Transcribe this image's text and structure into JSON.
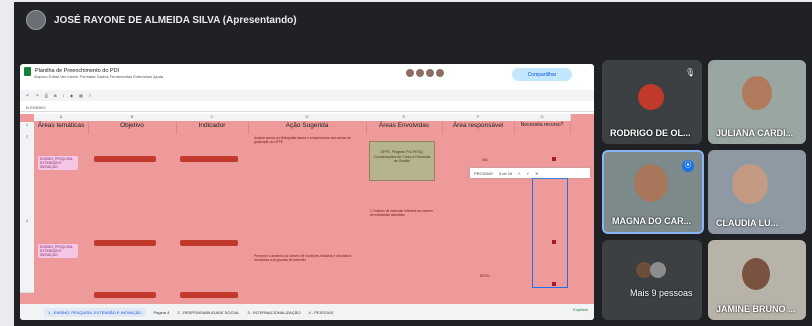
{
  "presenter": {
    "label": "JOSÉ RAYONE DE ALMEIDA SILVA (Apresentando)"
  },
  "sheet": {
    "title": "Planilha de Preenchimento do PDI",
    "menu": "Arquivo  Editar  Ver  Inserir  Formatar  Dados  Ferramentas  Extensões  Ajuda",
    "share_label": "Compartilhar",
    "formula": "fx  ENSINO",
    "find_label": "PROXIMO",
    "find_count": "3 de 16",
    "headers": [
      "Áreas temáticas",
      "Objetivo",
      "Indicador",
      "Ação Sugerida",
      "Áreas Envolvidas",
      "Área responsável",
      "Necessita recurso?"
    ],
    "rows": [
      {
        "area": "ENSINO, PESQUISA, EXTENSÃO E INOVAÇÃO",
        "action": "Ampliar acervo da bibliografia básica e complementar dos cursos de graduação do UFPE",
        "envolvidas": "UFPE, Program Pró-PESQ, Coordenações de Curso e Diretorias de Gestão",
        "responsavel": "BIB"
      },
      {
        "area": "ENSINO, PESQUISA, EXTENSÃO E INOVAÇÃO",
        "action": "Promover o aumento do número de monitores bolsistas e voluntários vinculados a programas de extensão",
        "envolvidas": "1. Número de extensão referente ao número de estudantes atendidos",
        "responsavel": "DEXEL"
      }
    ],
    "tabs": [
      "1 - ENSINO, PESQUISA, EXTENSÃO E INOVAÇÃO",
      "Página 4",
      "2 - RESPONSABILIDADE SOCIAL",
      "3 - INTERNACIONALIZAÇÃO",
      "4 - PESSOAS"
    ],
    "explore": "Explorar"
  },
  "participants": [
    {
      "name": "RODRIGO DE OL..."
    },
    {
      "name": "JULIANA CARDI..."
    },
    {
      "name": "MAGNA DO CAR..."
    },
    {
      "name": "CLAUDIA LU..."
    },
    {
      "name": "Mais 9 pessoas"
    },
    {
      "name": "JAMINE BRUNO ..."
    }
  ],
  "colors": {
    "accent": "#1a73e8",
    "sheet_fill": "#ee9a9a",
    "meet_bg": "#202124"
  }
}
